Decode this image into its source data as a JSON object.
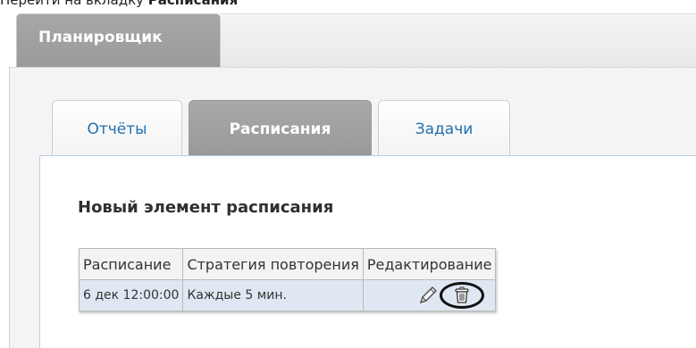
{
  "caption": {
    "prefix": "Перейти на вкладку ",
    "bold": "Расписания"
  },
  "outer_tab": {
    "label": "Планировщик"
  },
  "tabs": [
    {
      "label": "Отчёты",
      "active": false
    },
    {
      "label": "Расписания",
      "active": true
    },
    {
      "label": "Задачи",
      "active": false
    }
  ],
  "panel": {
    "title": "Новый элемент расписания"
  },
  "table": {
    "headers": [
      "Расписание",
      "Стратегия повторения",
      "Редактирование"
    ],
    "rows": [
      {
        "schedule": "6 дек 12:00:00",
        "strategy": "Каждые 5 мин."
      }
    ]
  },
  "icons": {
    "edit": "pencil-icon",
    "delete": "trash-icon"
  },
  "colors": {
    "tab_link": "#2470b0",
    "active_tab": "#a0a0a0",
    "row_bg": "#dfe8f2",
    "panel_border": "#b7cde2"
  }
}
